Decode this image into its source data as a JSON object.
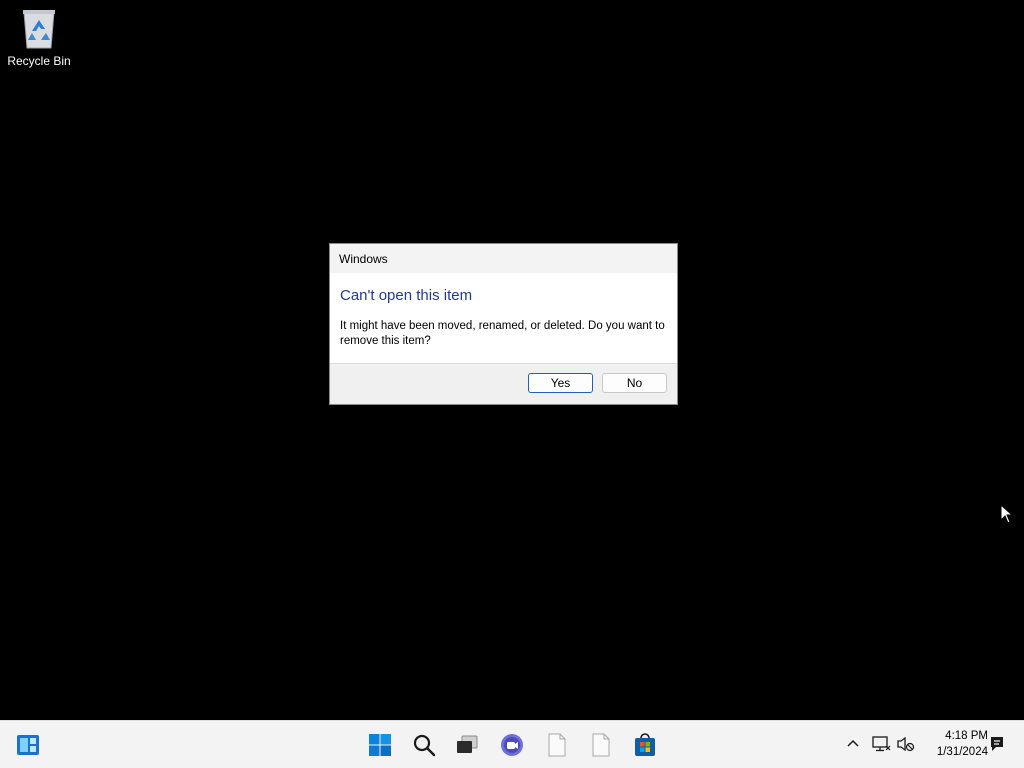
{
  "desktop": {
    "icons": [
      {
        "label": "Recycle Bin",
        "icon": "recycle-bin-icon"
      }
    ]
  },
  "dialog": {
    "title": "Windows",
    "heading": "Can't open this item",
    "message": "It might have been moved, renamed, or deleted. Do you want to remove this item?",
    "yes_label": "Yes",
    "no_label": "No",
    "heading_color": "#1f3c8f",
    "accent_color": "#1e5fbf"
  },
  "taskbar": {
    "left_icons": [
      "widgets-icon"
    ],
    "center_icons": [
      "start-icon",
      "search-icon",
      "task-view-icon",
      "chat-icon",
      "file-icon",
      "file-icon",
      "store-icon"
    ],
    "tray_icons": [
      "chevron-up-icon",
      "network-icon",
      "volume-muted-icon",
      "notification-icon"
    ],
    "time": "4:18 PM",
    "date": "1/31/2024"
  }
}
